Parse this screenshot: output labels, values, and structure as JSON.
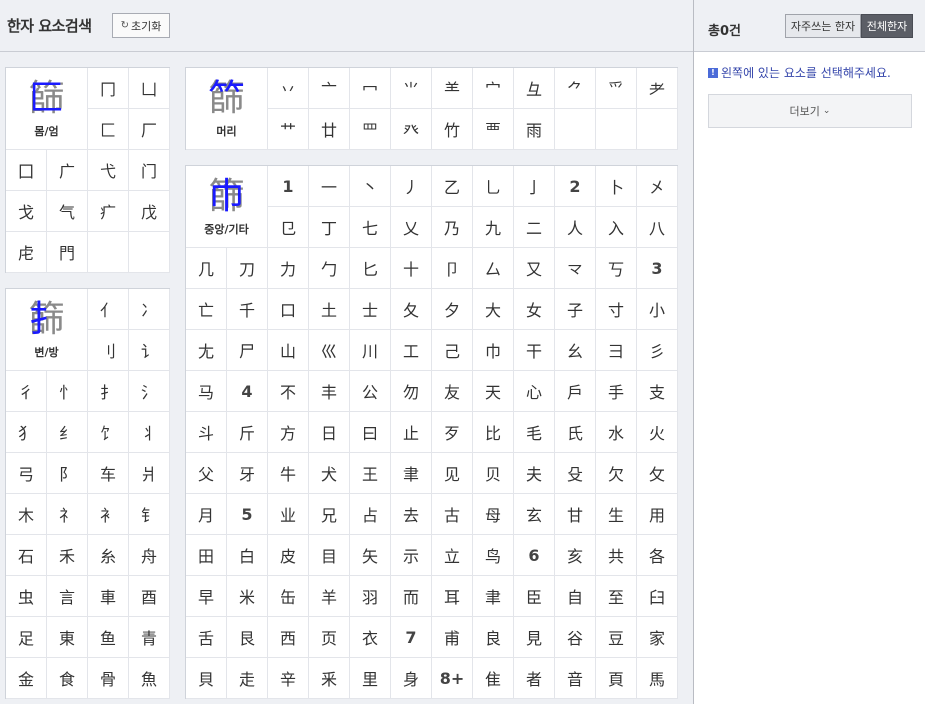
{
  "header": {
    "title": "한자 요소검색",
    "reset_label": "초기화",
    "reset_icon": "refresh-icon"
  },
  "sidebar": {
    "count": "총0건",
    "tab_frequent": "자주쓰는 한자",
    "tab_all": "전체한자",
    "notice": "왼쪽에 있는 요소를 선택해주세요.",
    "notice_icon": "info-icon",
    "more_label": "더보기",
    "more_icon": "chevron-down-icon"
  },
  "colors": {
    "highlight": "#1a1aff",
    "accent_dark": "#5b5e66",
    "notice_text": "#3344aa"
  },
  "panels": {
    "enclosure": {
      "label": "몸/엄",
      "sample": "篩",
      "overlay": "匚",
      "top_cells": [
        "冂",
        "凵",
        "匚",
        "厂"
      ],
      "rest": [
        "囗",
        "广",
        "弋",
        "门",
        "戈",
        "气",
        "疒",
        "戊",
        "虍",
        "門",
        "",
        ""
      ]
    },
    "side": {
      "label": "변/방",
      "sample": "篩",
      "overlay": "扌",
      "top_cells": [
        "亻",
        "冫",
        "刂",
        "讠"
      ],
      "rest": [
        "彳",
        "忄",
        "扌",
        "氵",
        "犭",
        "纟",
        "饣",
        "丬",
        "弓",
        "阝",
        "车",
        "爿",
        "木",
        "礻",
        "衤",
        "钅",
        "石",
        "禾",
        "糸",
        "舟",
        "虫",
        "言",
        "車",
        "酉",
        "足",
        "東",
        "鱼",
        "青",
        "金",
        "食",
        "骨",
        "魚"
      ]
    },
    "head": {
      "label": "머리",
      "sample": "篩",
      "overlay": "⺮",
      "cells": [
        "丷",
        "亠",
        "冖",
        "⺌",
        "⺷",
        "宀",
        "彑",
        "⺈",
        "爫",
        "耂",
        "艹",
        "廿",
        "罒",
        "癶",
        "竹",
        "覀",
        "雨",
        "",
        "",
        ""
      ]
    },
    "middle": {
      "label": "중앙/기타",
      "sample": "篩",
      "overlay": "巾",
      "top_cells": [
        "1",
        "一",
        "丶",
        "丿",
        "乙",
        "乚",
        "亅",
        "2",
        "卜",
        "㐅",
        "㔾",
        "丁",
        "七",
        "乂",
        "乃",
        "九",
        "二",
        "人",
        "入",
        "八"
      ],
      "rest": [
        "几",
        "刀",
        "力",
        "勹",
        "匕",
        "十",
        "卩",
        "厶",
        "又",
        "龴",
        "丂",
        "3",
        "亡",
        "千",
        "口",
        "土",
        "士",
        "夂",
        "夕",
        "大",
        "女",
        "子",
        "寸",
        "小",
        "尢",
        "尸",
        "山",
        "巛",
        "川",
        "工",
        "己",
        "巾",
        "干",
        "幺",
        "彐",
        "彡",
        "马",
        "4",
        "不",
        "丰",
        "公",
        "勿",
        "友",
        "天",
        "心",
        "戶",
        "手",
        "支",
        "斗",
        "斤",
        "方",
        "日",
        "曰",
        "止",
        "歹",
        "比",
        "毛",
        "氏",
        "水",
        "火",
        "父",
        "牙",
        "牛",
        "犬",
        "王",
        "聿",
        "见",
        "贝",
        "夫",
        "殳",
        "欠",
        "攵",
        "月",
        "5",
        "业",
        "兄",
        "占",
        "去",
        "古",
        "母",
        "玄",
        "甘",
        "生",
        "用",
        "田",
        "白",
        "皮",
        "目",
        "矢",
        "示",
        "立",
        "鸟",
        "6",
        "亥",
        "共",
        "各",
        "早",
        "米",
        "缶",
        "羊",
        "羽",
        "而",
        "耳",
        "聿",
        "臣",
        "自",
        "至",
        "臼",
        "舌",
        "艮",
        "西",
        "页",
        "衣",
        "7",
        "甫",
        "良",
        "見",
        "谷",
        "豆",
        "家",
        "貝",
        "走",
        "辛",
        "釆",
        "里",
        "身",
        "8+",
        "隹",
        "者",
        "音",
        "頁",
        "馬"
      ],
      "stroke_labels": [
        "1",
        "2",
        "3",
        "4",
        "5",
        "6",
        "7",
        "8+"
      ]
    }
  }
}
